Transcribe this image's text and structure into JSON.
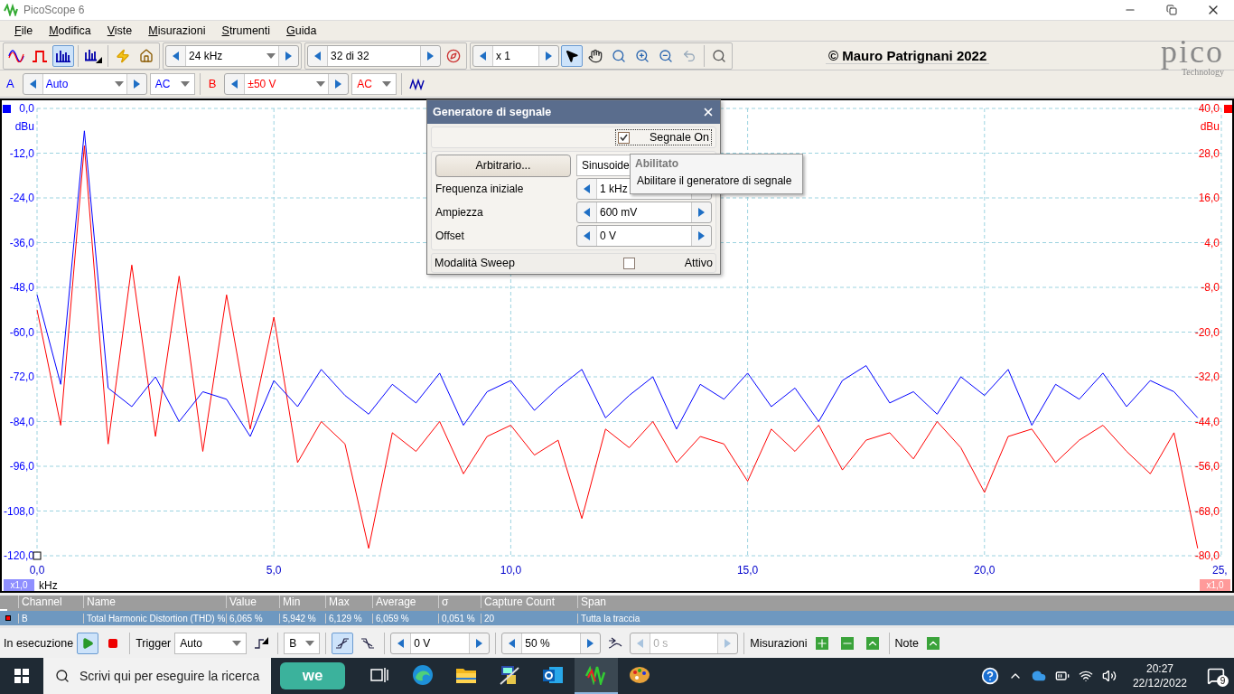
{
  "window": {
    "title": "PicoScope 6"
  },
  "menu": [
    {
      "label": "File"
    },
    {
      "label": "Modifica"
    },
    {
      "label": "Viste"
    },
    {
      "label": "Misurazioni"
    },
    {
      "label": "Strumenti"
    },
    {
      "label": "Guida"
    }
  ],
  "toolbar": {
    "view_modes": [
      {
        "kind": "scope",
        "selected": false
      },
      {
        "kind": "persistence",
        "selected": false
      },
      {
        "kind": "spectrum",
        "selected": true
      },
      {
        "kind": "spectrum-options",
        "selected": false
      }
    ],
    "timebase": "24 kHz",
    "buffer": "32 di 32",
    "zoom": "x 1",
    "tools": [
      {
        "kind": "pointer",
        "selected": true
      },
      {
        "kind": "hand",
        "selected": false
      },
      {
        "kind": "zoom",
        "selected": false
      },
      {
        "kind": "zoom-in",
        "selected": false
      },
      {
        "kind": "zoom-out",
        "selected": false
      },
      {
        "kind": "undo",
        "selected": false,
        "disabled": true
      },
      {
        "kind": "zoom-fit",
        "selected": false
      }
    ],
    "copyright": "© Mauro Patrignani 2022",
    "logo": {
      "name": "pico",
      "tagline": "Technology"
    }
  },
  "channels": [
    {
      "name": "A",
      "range": "Auto",
      "coupling": "AC",
      "color": "#0000ff"
    },
    {
      "name": "B",
      "range": "±50 V",
      "coupling": "AC",
      "color": "#ff0000"
    }
  ],
  "scope": {
    "left_scale": "x1,0",
    "right_scale": "x1,0",
    "chart_data": {
      "type": "line",
      "grid": true,
      "xlabel": "kHz",
      "ylabel": "dBu",
      "y2label": "dBu",
      "xlim": [
        0,
        25
      ],
      "ylim": [
        -120,
        0
      ],
      "y2lim": [
        -80,
        40
      ],
      "xticks": [
        {
          "value": 0,
          "label": "0,0"
        },
        {
          "value": 5,
          "label": "5,0"
        },
        {
          "value": 10,
          "label": "10,0"
        },
        {
          "value": 15,
          "label": "15,0"
        },
        {
          "value": 20,
          "label": "20,0"
        },
        {
          "value": 25,
          "label": "25,"
        }
      ],
      "yticks": [
        {
          "value": 0,
          "label": "0,0"
        },
        {
          "value": -12,
          "label": "-12,0"
        },
        {
          "value": -24,
          "label": "-24,0"
        },
        {
          "value": -36,
          "label": "-36,0"
        },
        {
          "value": -48,
          "label": "-48,0"
        },
        {
          "value": -60,
          "label": "-60,0"
        },
        {
          "value": -72,
          "label": "-72,0"
        },
        {
          "value": -84,
          "label": "-84,0"
        },
        {
          "value": -96,
          "label": "-96,0"
        },
        {
          "value": -108,
          "label": "-108,0"
        },
        {
          "value": -120,
          "label": "-120,0"
        }
      ],
      "y2ticks": [
        {
          "value": 40,
          "label": "40,0"
        },
        {
          "value": 28,
          "label": "28,0"
        },
        {
          "value": 16,
          "label": "16,0"
        },
        {
          "value": 4,
          "label": "4,0"
        },
        {
          "value": -8,
          "label": "-8,0"
        },
        {
          "value": -20,
          "label": "-20,0"
        },
        {
          "value": -32,
          "label": "-32,0"
        },
        {
          "value": -44,
          "label": "-44,0"
        },
        {
          "value": -56,
          "label": "-56,0"
        },
        {
          "value": -68,
          "label": "-68,0"
        },
        {
          "value": -80,
          "label": "-80,0"
        }
      ],
      "x": [
        0,
        0.5,
        1,
        1.5,
        2,
        2.5,
        3,
        3.5,
        4,
        4.5,
        5,
        5.5,
        6,
        6.5,
        7,
        7.5,
        8,
        8.5,
        9,
        9.5,
        10,
        10.5,
        11,
        11.5,
        12,
        12.5,
        13,
        13.5,
        14,
        14.5,
        15,
        15.5,
        16,
        16.5,
        17,
        17.5,
        18,
        18.5,
        19,
        19.5,
        20,
        20.5,
        21,
        21.5,
        22,
        22.5,
        23,
        23.5,
        24,
        24.5
      ],
      "series": [
        {
          "color": "#ff0000",
          "axis": "y2",
          "values": [
            -14,
            -45,
            30,
            -50,
            -2,
            -48,
            -5,
            -52,
            -10,
            -46,
            -16,
            -55,
            -44,
            -50,
            -78,
            -47,
            -52,
            -44,
            -58,
            -48,
            -45,
            -53,
            -49,
            -70,
            -46,
            -51,
            -44,
            -55,
            -48,
            -50,
            -60,
            -46,
            -52,
            -45,
            -57,
            -49,
            -47,
            -54,
            -44,
            -51,
            -63,
            -48,
            -46,
            -55,
            -49,
            -45,
            -52,
            -58,
            -47,
            -78
          ]
        },
        {
          "color": "#0000ff",
          "values": [
            -50,
            -74,
            -6,
            -75,
            -80,
            -72,
            -84,
            -76,
            -78,
            -88,
            -73,
            -80,
            -70,
            -77,
            -82,
            -74,
            -79,
            -71,
            -85,
            -76,
            -73,
            -81,
            -75,
            -70,
            -83,
            -77,
            -72,
            -86,
            -74,
            -78,
            -71,
            -80,
            -75,
            -84,
            -73,
            -69,
            -79,
            -76,
            -82,
            -72,
            -77,
            -70,
            -85,
            -74,
            -78,
            -71,
            -80,
            -73,
            -76,
            -83
          ]
        }
      ]
    }
  },
  "measurements": {
    "columns": [
      "Channel",
      "Name",
      "Value",
      "Min",
      "Max",
      "Average",
      "σ",
      "Capture Count",
      "Span"
    ],
    "rows": [
      {
        "selected": true,
        "color": "#ff0000",
        "cells": [
          "B",
          "Total Harmonic Distortion (THD) %",
          "6,065 %",
          "5,942 %",
          "6,129 %",
          "6,059 %",
          "0,051 %",
          "20",
          "Tutta la traccia"
        ]
      }
    ]
  },
  "status_bar": {
    "run_label": "In esecuzione",
    "running": true,
    "trigger_label": "Trigger",
    "trigger_mode": "Auto",
    "trigger_channel": "B",
    "edges": [
      {
        "kind": "rising",
        "selected": true
      },
      {
        "kind": "falling",
        "selected": false
      }
    ],
    "threshold": "0 V",
    "pre_trigger": "50 %",
    "delay": {
      "value": "0 s",
      "disabled": true
    },
    "measurements_label": "Misurazioni",
    "notes_label": "Note"
  },
  "signal_generator": {
    "title": "Generatore di segnale",
    "signal_on": {
      "label": "Segnale On",
      "checked": true
    },
    "waveform_button": "Arbitrario...",
    "waveform": "Sinusoide",
    "fields": [
      {
        "label": "Frequenza iniziale",
        "value": "1 kHz"
      },
      {
        "label": "Ampiezza",
        "value": "600 mV"
      },
      {
        "label": "Offset",
        "value": "0 V"
      }
    ],
    "sweep": {
      "label": "Modalità Sweep",
      "checkbox_label": "Attivo",
      "checked": false
    }
  },
  "tooltip": {
    "title": "Abilitato",
    "text": "Abilitare il generatore di segnale"
  },
  "taskbar": {
    "search_placeholder": "Scrivi qui per eseguire la ricerca",
    "widget": "we",
    "apps": [
      {
        "kind": "task-view",
        "selected": false
      },
      {
        "kind": "browser",
        "selected": false
      },
      {
        "kind": "folder",
        "selected": false
      },
      {
        "kind": "network",
        "selected": false
      },
      {
        "kind": "mail",
        "selected": false
      },
      {
        "kind": "oscilloscope",
        "selected": true
      },
      {
        "kind": "palette",
        "selected": false
      }
    ],
    "time": "20:27",
    "date": "22/12/2022",
    "notifications": "9"
  }
}
